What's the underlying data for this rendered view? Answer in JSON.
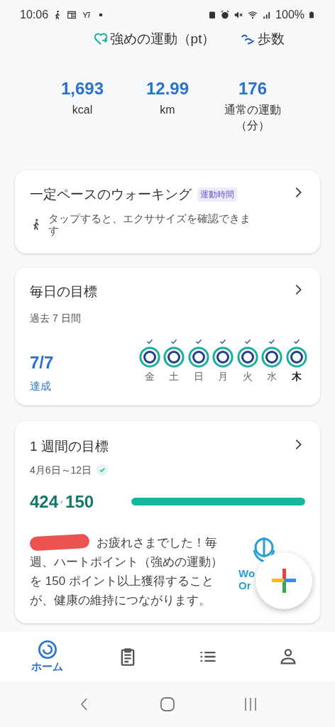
{
  "status_bar": {
    "time": "10:06",
    "battery": "100%"
  },
  "metric_tabs": [
    {
      "label": "強めの運動（pt）",
      "kind": "heart"
    },
    {
      "label": "歩数",
      "kind": "steps"
    }
  ],
  "stats": [
    {
      "value": "1,693",
      "label": "kcal"
    },
    {
      "value": "12.99",
      "label": "km"
    },
    {
      "value": "176",
      "label": "通常の運動（分）"
    }
  ],
  "activity_card": {
    "title": "一定ペースのウォーキング",
    "badge": "運動時間",
    "hint": "タップすると、エクササイズを確認できます"
  },
  "daily_goal": {
    "title": "毎日の目標",
    "period": "過去 7 日間",
    "score": "7/7",
    "status": "達成",
    "days": [
      {
        "label": "金",
        "achieved": true,
        "today": false
      },
      {
        "label": "土",
        "achieved": true,
        "today": false
      },
      {
        "label": "日",
        "achieved": true,
        "today": false
      },
      {
        "label": "月",
        "achieved": true,
        "today": false
      },
      {
        "label": "火",
        "achieved": true,
        "today": false
      },
      {
        "label": "水",
        "achieved": true,
        "today": false
      },
      {
        "label": "木",
        "achieved": true,
        "today": true
      }
    ]
  },
  "weekly_goal": {
    "title": "1 週間の目標",
    "dates": "4月6日～12日",
    "achieved": true,
    "current": "424",
    "target": "150",
    "level": 1,
    "message": [
      "お疲れさまでした！毎",
      "週、ハートポイント（強めの運動）を 150 ポイント以上獲得することが、健康の維持につながります。"
    ],
    "logo_text": [
      "Wo",
      "Or"
    ]
  },
  "bottom_nav": [
    {
      "label": "ホーム",
      "kind": "home",
      "selected": true
    },
    {
      "kind": "journal",
      "selected": false
    },
    {
      "kind": "browse",
      "selected": false
    },
    {
      "kind": "profile",
      "selected": false
    }
  ]
}
